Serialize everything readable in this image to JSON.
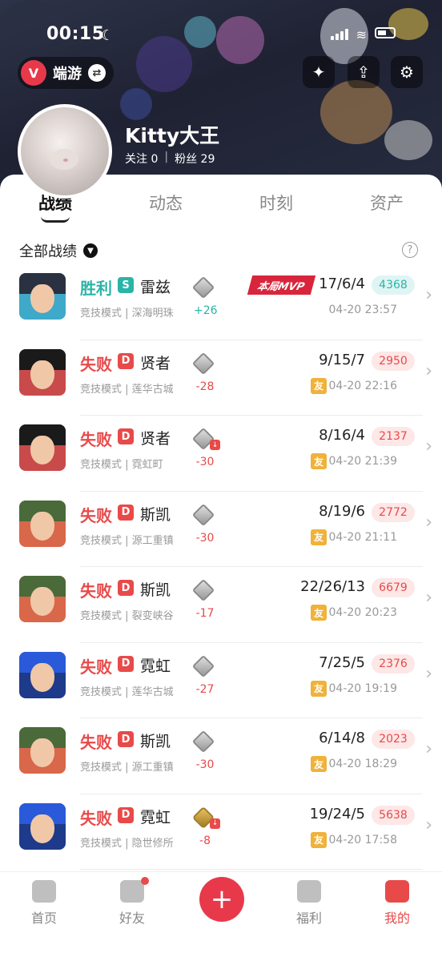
{
  "status_bar": {
    "time": "00:15"
  },
  "brand": {
    "label": "端游"
  },
  "profile": {
    "name": "Kitty大王",
    "following_label": "关注",
    "following_count": "0",
    "fans_label": "粉丝",
    "fans_count": "29"
  },
  "tabs": [
    "战绩",
    "动态",
    "时刻",
    "资产"
  ],
  "filter": {
    "label": "全部战绩"
  },
  "mvp_label": "本局MVP",
  "friend_label": "友",
  "matches": [
    {
      "result": "胜利",
      "rank_letter": "S",
      "agent": "雷兹",
      "mode": "竞技模式 | 深海明珠",
      "rr": "+26",
      "kda": "17/6/4",
      "score": "4368",
      "time": "04-20 23:57",
      "mvp": true,
      "friend": false,
      "outcome": "win"
    },
    {
      "result": "失败",
      "rank_letter": "D",
      "agent": "贤者",
      "mode": "竞技模式 | 莲华古城",
      "rr": "-28",
      "kda": "9/15/7",
      "score": "2950",
      "time": "04-20 22:16",
      "mvp": false,
      "friend": true,
      "outcome": "loss"
    },
    {
      "result": "失败",
      "rank_letter": "D",
      "agent": "贤者",
      "mode": "竞技模式 | 霓虹町",
      "rr": "-30",
      "kda": "8/16/4",
      "score": "2137",
      "time": "04-20 21:39",
      "mvp": false,
      "friend": true,
      "outcome": "loss",
      "derank": true
    },
    {
      "result": "失败",
      "rank_letter": "D",
      "agent": "斯凯",
      "mode": "竞技模式 | 源工重镇",
      "rr": "-30",
      "kda": "8/19/6",
      "score": "2772",
      "time": "04-20 21:11",
      "mvp": false,
      "friend": true,
      "outcome": "loss"
    },
    {
      "result": "失败",
      "rank_letter": "D",
      "agent": "斯凯",
      "mode": "竞技模式 | 裂变峡谷",
      "rr": "-17",
      "kda": "22/26/13",
      "score": "6679",
      "time": "04-20 20:23",
      "mvp": false,
      "friend": true,
      "outcome": "loss"
    },
    {
      "result": "失败",
      "rank_letter": "D",
      "agent": "霓虹",
      "mode": "竞技模式 | 莲华古城",
      "rr": "-27",
      "kda": "7/25/5",
      "score": "2376",
      "time": "04-20 19:19",
      "mvp": false,
      "friend": true,
      "outcome": "loss"
    },
    {
      "result": "失败",
      "rank_letter": "D",
      "agent": "斯凯",
      "mode": "竞技模式 | 源工重镇",
      "rr": "-30",
      "kda": "6/14/8",
      "score": "2023",
      "time": "04-20 18:29",
      "mvp": false,
      "friend": true,
      "outcome": "loss"
    },
    {
      "result": "失败",
      "rank_letter": "D",
      "agent": "霓虹",
      "mode": "竞技模式 | 隐世修所",
      "rr": "-8",
      "kda": "19/24/5",
      "score": "5638",
      "time": "04-20 17:58",
      "mvp": false,
      "friend": true,
      "outcome": "loss",
      "derank": true,
      "gold_rank": true
    }
  ],
  "bottom_nav": [
    "首页",
    "好友",
    "福利",
    "我的"
  ],
  "colors": {
    "accent": "#e8394b",
    "win": "#2ab4a8",
    "loss": "#e84a4a",
    "friend": "#f0b23a"
  }
}
